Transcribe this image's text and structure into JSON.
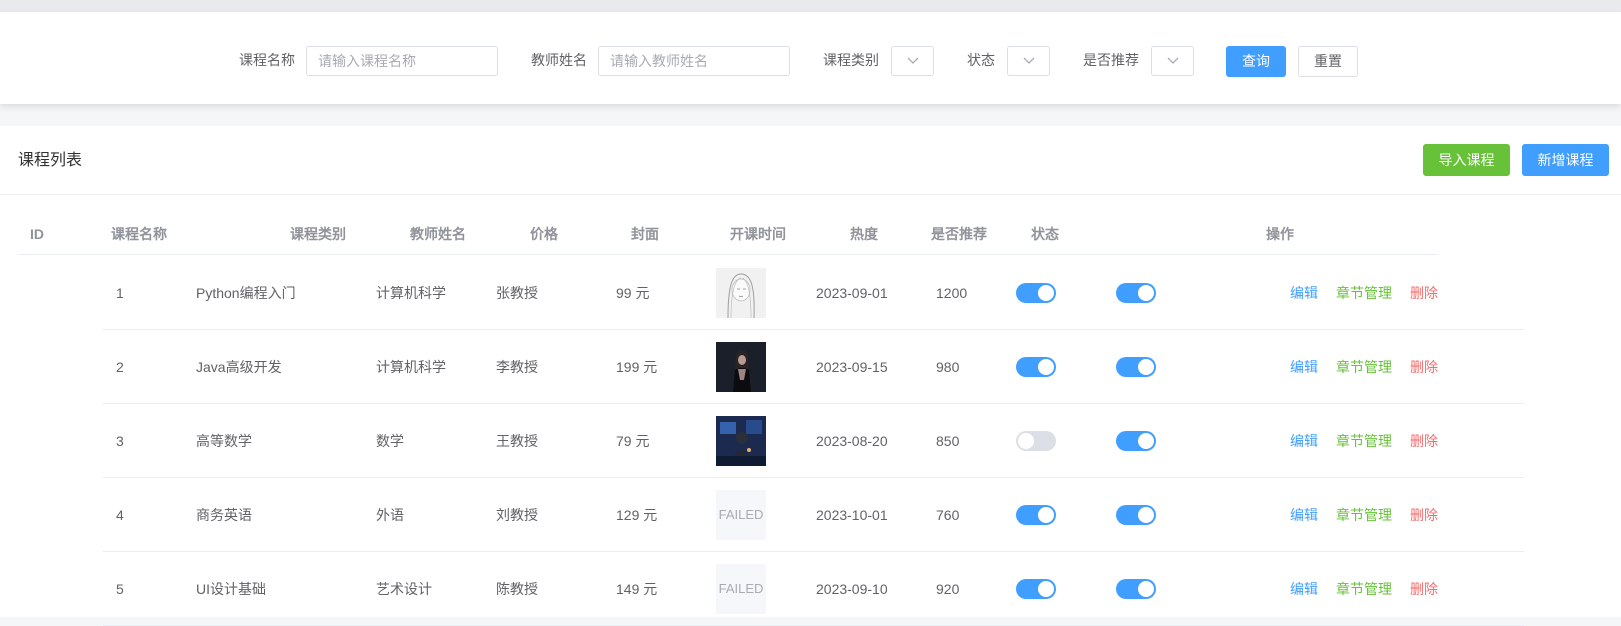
{
  "filters": {
    "course_name": {
      "label": "课程名称",
      "placeholder": "请输入课程名称"
    },
    "teacher_name": {
      "label": "教师姓名",
      "placeholder": "请输入教师姓名"
    },
    "category": {
      "label": "课程类别",
      "value": ""
    },
    "status": {
      "label": "状态",
      "value": ""
    },
    "recommended": {
      "label": "是否推荐",
      "value": ""
    },
    "query_button": "查询",
    "reset_button": "重置"
  },
  "list": {
    "title": "课程列表",
    "import_button": "导入课程",
    "add_button": "新增课程",
    "columns": [
      "ID",
      "课程名称",
      "课程类别",
      "教师姓名",
      "价格",
      "封面",
      "开课时间",
      "热度",
      "是否推荐",
      "状态",
      "操作"
    ],
    "rows": [
      {
        "id": "1",
        "name": "Python编程入门",
        "category": "计算机科学",
        "teacher": "张教授",
        "price": "99 元",
        "cover": "image-sketch-portrait",
        "cover_failed": false,
        "date": "2023-09-01",
        "heat": "1200",
        "recommended": true,
        "status": true
      },
      {
        "id": "2",
        "name": "Java高级开发",
        "category": "计算机科学",
        "teacher": "李教授",
        "price": "199 元",
        "cover": "image-dark-portrait",
        "cover_failed": false,
        "date": "2023-09-15",
        "heat": "980",
        "recommended": true,
        "status": true
      },
      {
        "id": "3",
        "name": "高等数学",
        "category": "数学",
        "teacher": "王教授",
        "price": "79 元",
        "cover": "image-night-desk",
        "cover_failed": false,
        "date": "2023-08-20",
        "heat": "850",
        "recommended": false,
        "status": true
      },
      {
        "id": "4",
        "name": "商务英语",
        "category": "外语",
        "teacher": "刘教授",
        "price": "129 元",
        "cover": "FAILED",
        "cover_failed": true,
        "date": "2023-10-01",
        "heat": "760",
        "recommended": true,
        "status": true
      },
      {
        "id": "5",
        "name": "UI设计基础",
        "category": "艺术设计",
        "teacher": "陈教授",
        "price": "149 元",
        "cover": "FAILED",
        "cover_failed": true,
        "date": "2023-09-10",
        "heat": "920",
        "recommended": true,
        "status": true
      }
    ],
    "actions": {
      "edit": "编辑",
      "chapter": "章节管理",
      "delete": "删除"
    }
  },
  "colors": {
    "primary": "#409eff",
    "success": "#67c23a",
    "danger": "#f56c6c",
    "switch_off": "#dcdfe6"
  }
}
